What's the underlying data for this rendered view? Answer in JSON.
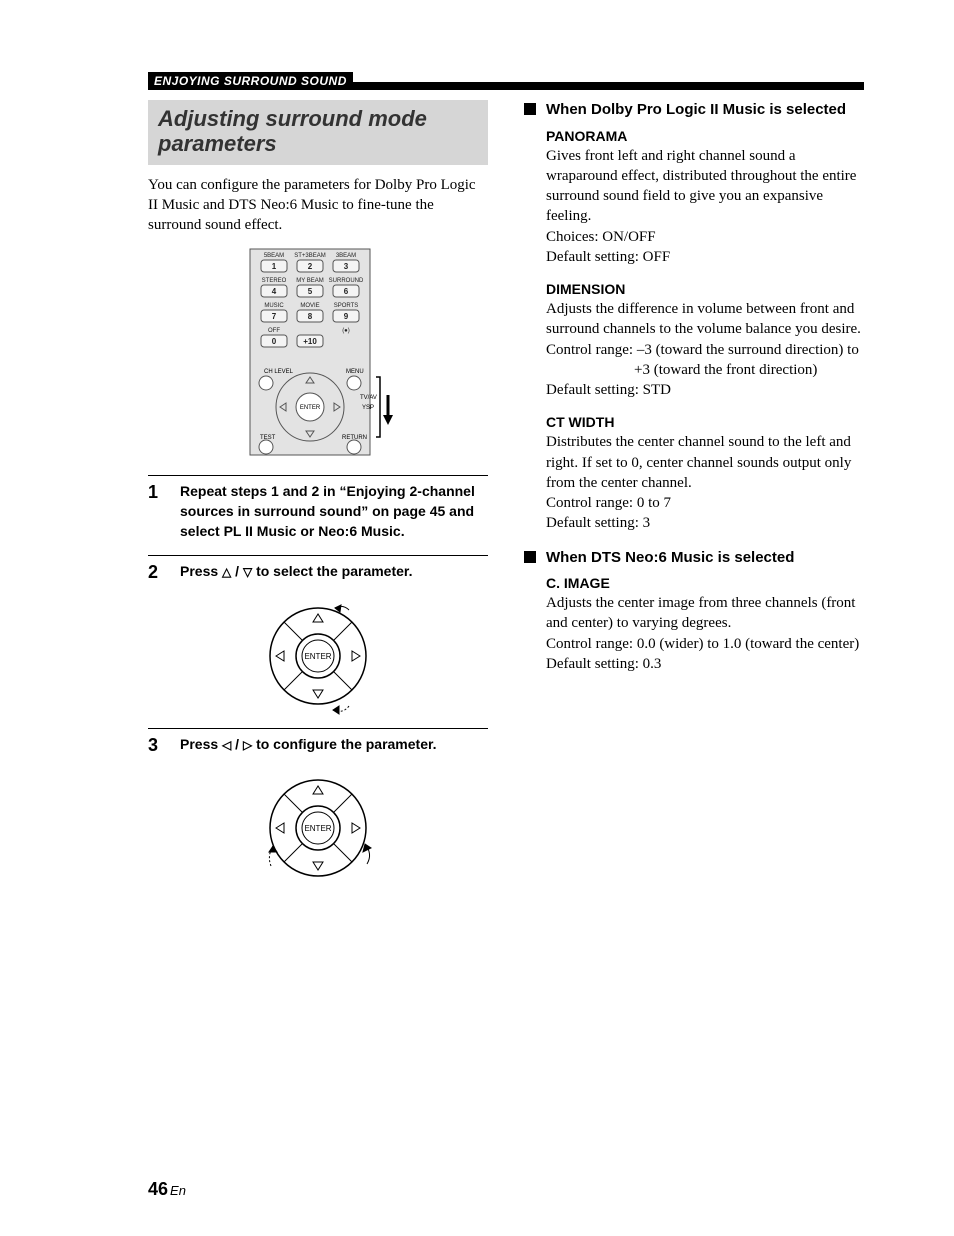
{
  "header": {
    "section_title": "ENJOYING SURROUND SOUND"
  },
  "left": {
    "box_title_line1": "Adjusting surround mode",
    "box_title_line2": "parameters",
    "intro": "You can configure the parameters for Dolby Pro Logic II Music and DTS Neo:6 Music to fine-tune the surround sound effect.",
    "steps": {
      "s1_num": "1",
      "s1_text": "Repeat steps 1 and 2 in “Enjoying 2-channel sources in surround sound” on page 45 and select PL II Music or Neo:6 Music.",
      "s2_num": "2",
      "s2_pre": "Press ",
      "s2_mid": " / ",
      "s2_post": " to select the parameter.",
      "s3_num": "3",
      "s3_pre": "Press ",
      "s3_mid": " / ",
      "s3_post": " to configure the parameter."
    },
    "remote": {
      "row_labels": [
        [
          "5BEAM",
          "ST+3BEAM",
          "3BEAM"
        ],
        [
          "STEREO",
          "MY BEAM",
          "SURROUND"
        ],
        [
          "MUSIC",
          "MOVIE",
          "SPORTS"
        ],
        [
          "OFF",
          "",
          "(●)"
        ]
      ],
      "keys": [
        [
          "1",
          "2",
          "3"
        ],
        [
          "4",
          "5",
          "6"
        ],
        [
          "7",
          "8",
          "9"
        ],
        [
          "0",
          "+10",
          ""
        ]
      ],
      "ch_level": "CH LEVEL",
      "menu": "MENU",
      "test": "TEST",
      "return": "RETURN",
      "tvav": "TV/AV",
      "ysp": "YSP",
      "enter": "ENTER"
    },
    "enter_label": "ENTER"
  },
  "right": {
    "dolby_title": "When Dolby Pro Logic II Music is selected",
    "panorama": {
      "name": "PANORAMA",
      "desc": "Gives front left and right channel sound a wraparound effect, distributed throughout the entire surround sound field to give you an expansive feeling.",
      "choices": "Choices: ON/OFF",
      "default": "Default setting: OFF"
    },
    "dimension": {
      "name": "DIMENSION",
      "desc": "Adjusts the difference in volume between front and surround channels to the volume balance you desire.",
      "range1": "Control range: –3 (toward the surround direction) to",
      "range2": "+3 (toward the front direction)",
      "default": "Default setting: STD"
    },
    "ctwidth": {
      "name": "CT WIDTH",
      "desc": "Distributes the center channel sound to the left and right. If set to 0, center channel sounds output only from the center channel.",
      "range": "Control range: 0 to 7",
      "default": "Default setting: 3"
    },
    "dts_title": "When DTS Neo:6 Music is selected",
    "cimage": {
      "name": "C. IMAGE",
      "desc": "Adjusts the center image from three channels (front and center) to varying degrees.",
      "range": "Control range: 0.0 (wider) to 1.0 (toward the center)",
      "default": "Default setting: 0.3"
    }
  },
  "footer": {
    "page_num": "46",
    "suffix": "En"
  }
}
